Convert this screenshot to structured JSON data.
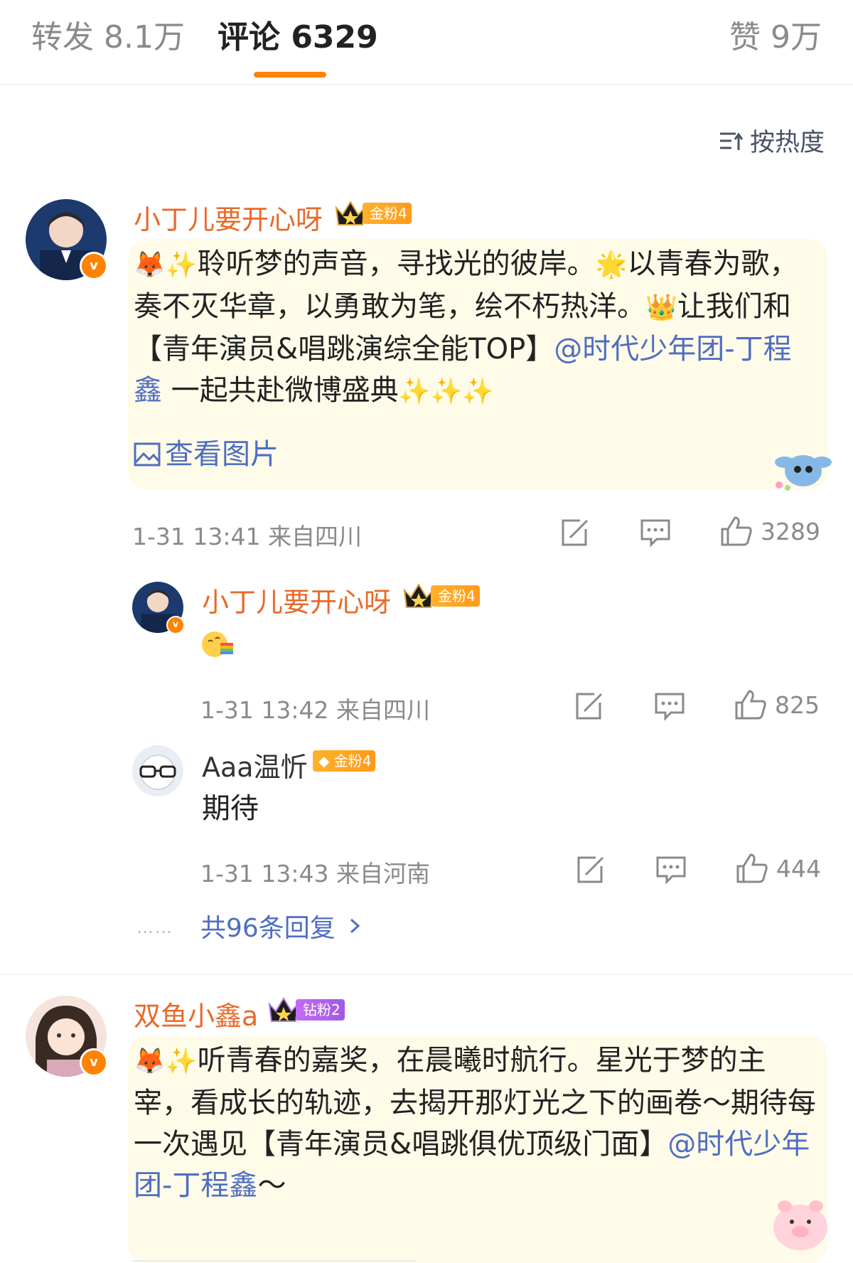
{
  "tabs": {
    "repost": "转发 8.1万",
    "comments": "评论 6329",
    "likes": "赞 9万"
  },
  "sort_label": "按热度",
  "comments": [
    {
      "user": "小丁儿要开心呀",
      "badge": "金粉4",
      "text_pre": "聆听梦的声音，寻找光的彼岸。",
      "text_mid": "以青春为歌，奏不灭华章，以勇敢为笔，绘不朽热洋。",
      "text_tail": "让我们和【青年演员&唱跳演综全能TOP】",
      "mention": "@时代少年团-丁程鑫",
      "text_end": " 一起共赴微博盛典",
      "image_link": "查看图片",
      "time": "1-31 13:41 来自四川",
      "likes": "3289",
      "replies": [
        {
          "user": "小丁儿要开心呀",
          "badge": "金粉4",
          "text": "",
          "time": "1-31 13:42 来自四川",
          "likes": "825"
        },
        {
          "user": "Aaa温忻",
          "badge": "金粉4",
          "text": "期待",
          "time": "1-31 13:43 来自河南",
          "likes": "444"
        }
      ],
      "more_replies": "共96条回复"
    },
    {
      "user": "双鱼小鑫a",
      "badge": "钻粉2",
      "text_pre": "听青春的嘉奖，在晨曦时航行。星光于梦的主宰，看成长的轨迹，去揭开那灯光之下的画卷～期待每一次遇见【青年演员&唱跳俱优顶级门面】",
      "mention": "@时代少年团-丁程鑫",
      "text_end": "～"
    }
  ],
  "colors": {
    "accent": "#ff8200",
    "username": "#e86a2a",
    "link": "#4f6ec2",
    "bubble": "#fffbe9"
  }
}
